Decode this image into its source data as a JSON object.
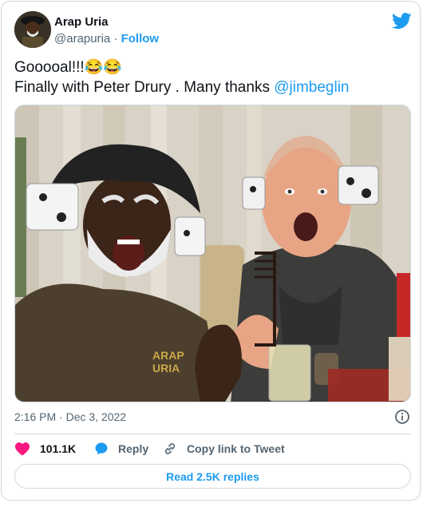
{
  "author": {
    "name": "Arap Uria",
    "handle": "@arapuria",
    "separator": "·",
    "follow_label": "Follow"
  },
  "tweet": {
    "line1": "Gooooal!!!😂😂",
    "line2_prefix": "Finally with Peter Drury . Many thanks ",
    "mention": "@jimbeglin",
    "timestamp": "2:16 PM · Dec 3, 2022"
  },
  "photo": {
    "shirt_text_line1": "ARAP",
    "shirt_text_line2": "URIA"
  },
  "actions": {
    "likes_count": "101.1K",
    "reply_label": "Reply",
    "copy_label": "Copy link to Tweet"
  },
  "read_replies_label": "Read 2.5K replies",
  "colors": {
    "accent": "#1d9bf0",
    "like": "#f91880",
    "muted": "#536471",
    "border": "#cfd9de"
  },
  "icons": [
    "twitter-bird-icon",
    "info-icon",
    "heart-icon",
    "reply-bubble-icon",
    "link-icon"
  ]
}
